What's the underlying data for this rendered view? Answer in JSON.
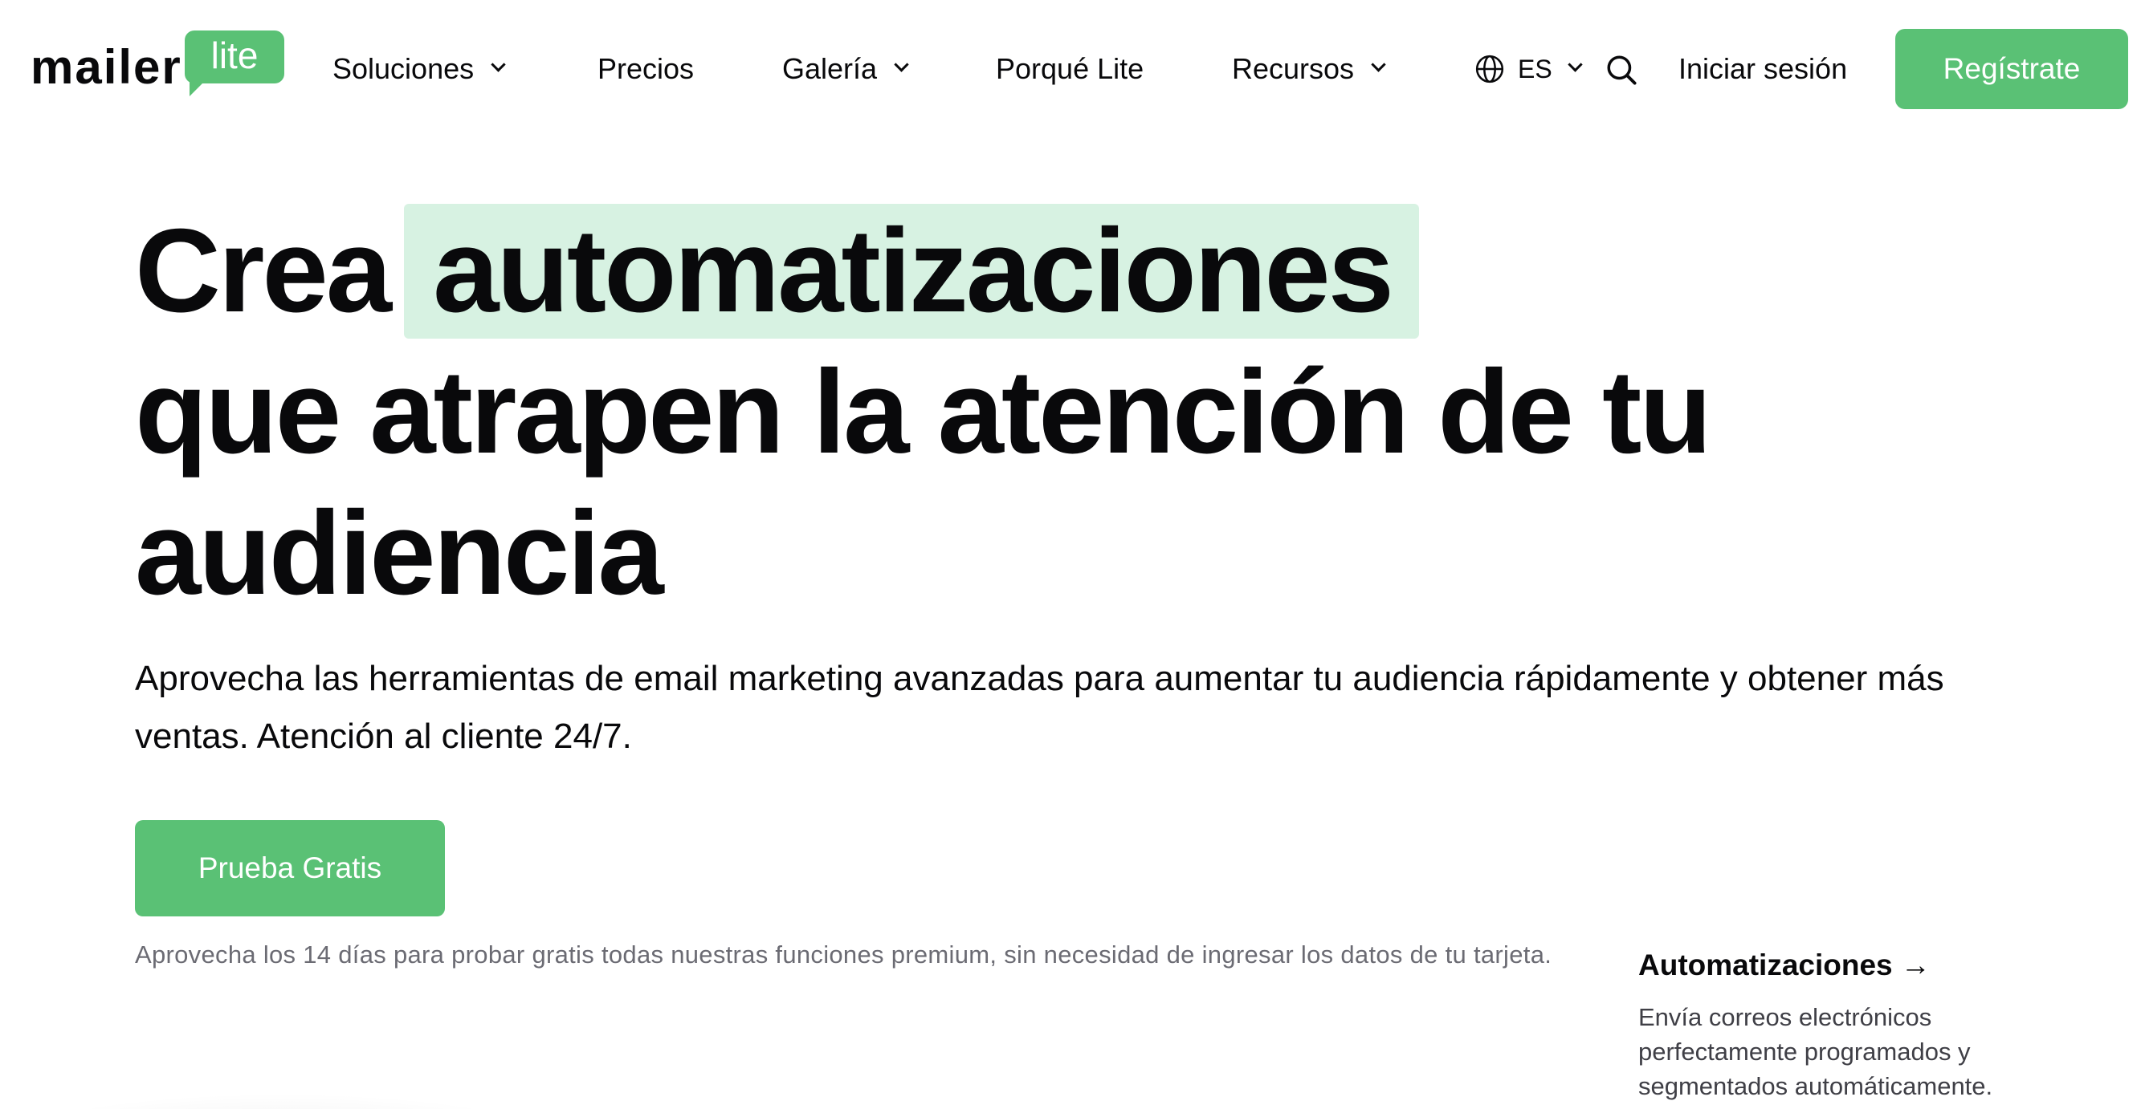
{
  "brand": {
    "logo_word": "mailer",
    "logo_badge": "lite",
    "accent_color": "#5ac175",
    "highlight_color": "#d7f2e2"
  },
  "nav": {
    "items": [
      {
        "label": "Soluciones",
        "has_dropdown": true
      },
      {
        "label": "Precios",
        "has_dropdown": false
      },
      {
        "label": "Galería",
        "has_dropdown": true
      },
      {
        "label": "Porqué Lite",
        "has_dropdown": false
      },
      {
        "label": "Recursos",
        "has_dropdown": true
      }
    ],
    "language": {
      "code": "ES",
      "icon": "globe-icon"
    },
    "search_icon": "search-icon",
    "login_label": "Iniciar sesión",
    "signup_label": "Regístrate"
  },
  "hero": {
    "title_prefix": "Crea",
    "title_highlight": "automatizaciones",
    "title_line2": "que atrapen la atención de tu",
    "title_line3": "audiencia",
    "subtitle": "Aprovecha las herramientas de email marketing avanzadas para aumentar tu audiencia rápidamente y obtener más ventas. Atención al cliente 24/7.",
    "cta_label": "Prueba Gratis",
    "note": "Aprovecha los 14 días para probar gratis todas nuestras funciones premium, sin necesidad de ingresar los datos de tu tarjeta."
  },
  "feature": {
    "title": "Automatizaciones →",
    "description": "Envía correos electrónicos perfectamente programados y segmentados automáticamente."
  }
}
